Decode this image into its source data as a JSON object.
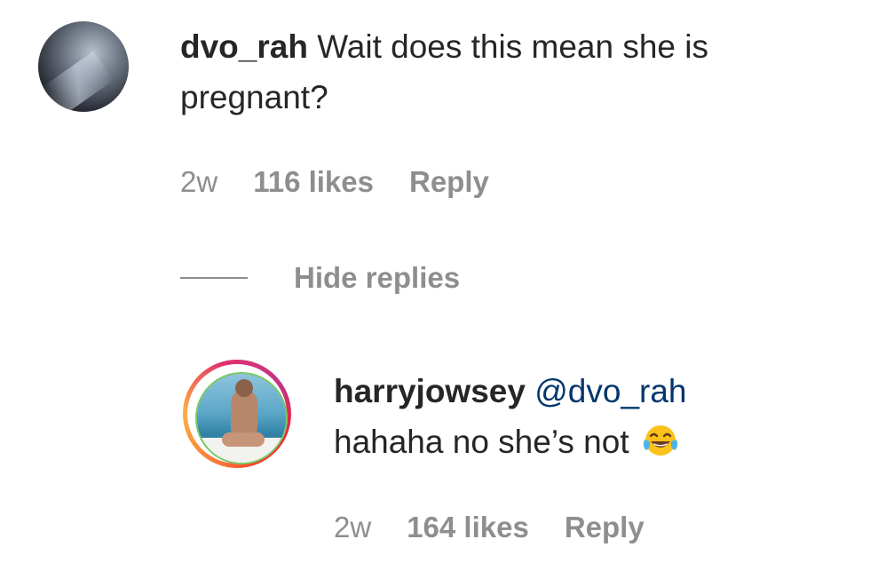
{
  "comments": [
    {
      "username": "dvo_rah",
      "text": "Wait does this mean she is pregnant?",
      "time": "2w",
      "likes": "116 likes",
      "reply_label": "Reply"
    }
  ],
  "hide_replies_label": "Hide replies",
  "replies": [
    {
      "username": "harryjowsey",
      "mention": "@dvo_rah",
      "text": "hahaha no she’s not",
      "emoji": "face-with-tears-of-joy-icon",
      "time": "2w",
      "likes": "164 likes",
      "reply_label": "Reply"
    }
  ],
  "colors": {
    "text": "#262626",
    "meta": "#8e8e8e",
    "mention": "#00376b",
    "story_ring": [
      "#f77737",
      "#fcaf45",
      "#e1306c",
      "#c13584"
    ]
  }
}
